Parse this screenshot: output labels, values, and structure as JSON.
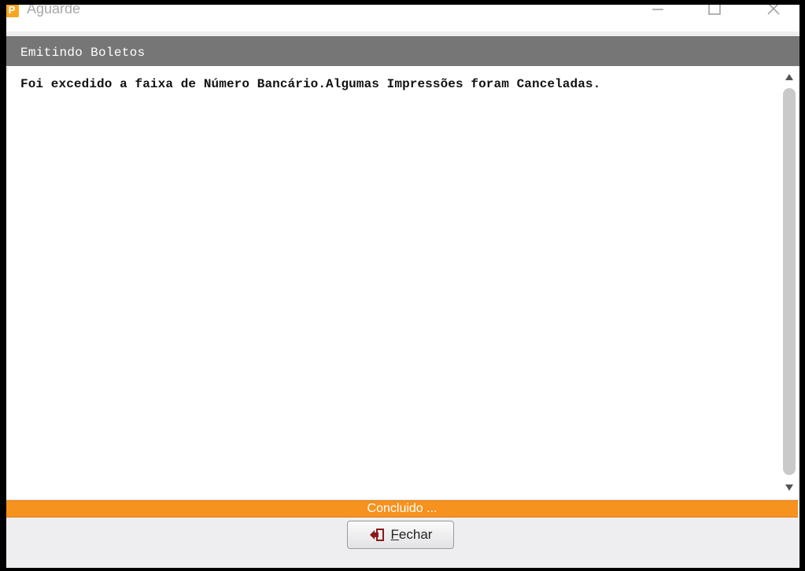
{
  "window": {
    "title": "Aguarde",
    "icon": "app-icon",
    "controls": [
      "minimize-icon",
      "maximize-icon",
      "close-icon"
    ]
  },
  "header": {
    "title": "Emitindo Boletos"
  },
  "content": {
    "message": "Foi excedido a faixa de Número Bancário.Algumas Impressões foram Canceladas."
  },
  "status": {
    "text": "Concluido ..."
  },
  "footer": {
    "close_button_first": "F",
    "close_button_rest": "echar",
    "icon": "exit-icon"
  },
  "colors": {
    "header": "#767676",
    "status": "#f6921e",
    "accent": "#8b1a1a"
  }
}
